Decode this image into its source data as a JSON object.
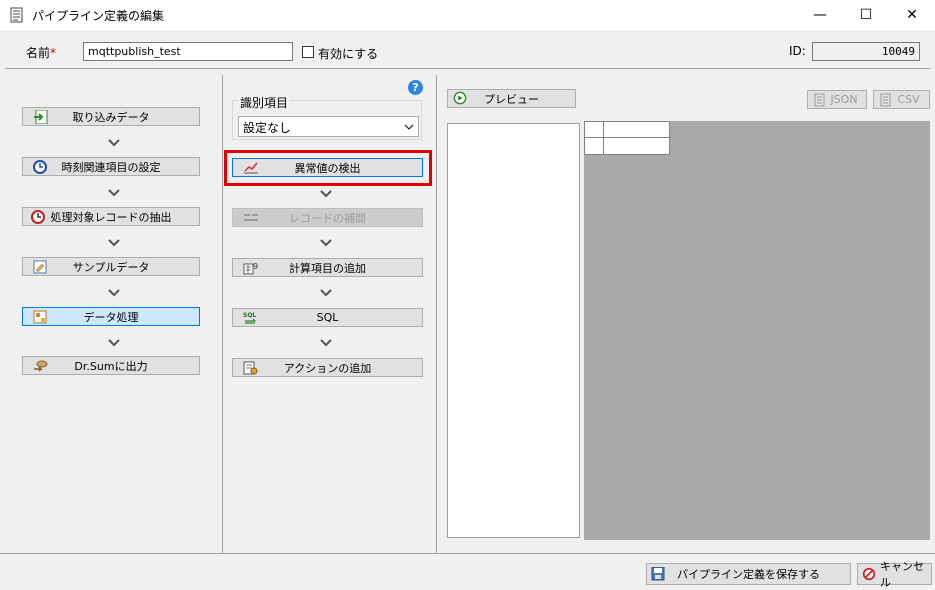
{
  "window": {
    "title": "パイプライン定義の編集",
    "minimize": "—",
    "maximize": "☐",
    "close": "✕"
  },
  "header": {
    "name_label": "名前",
    "required_mark": "*",
    "name_value": "mqttpublish_test",
    "enable_label": "有効にする",
    "id_label": "ID:",
    "id_value": "10049"
  },
  "steps": [
    {
      "label": "取り込みデータ",
      "icon": "import-icon"
    },
    {
      "label": "時刻関連項目の設定",
      "icon": "clock-icon"
    },
    {
      "label": "処理対象レコードの抽出",
      "icon": "extract-icon"
    },
    {
      "label": "サンプルデータ",
      "icon": "sample-icon"
    },
    {
      "label": "データ処理",
      "icon": "process-icon",
      "selected": true
    },
    {
      "label": "Dr.Sumに出力",
      "icon": "output-icon"
    }
  ],
  "middle": {
    "ident_label": "識別項目",
    "ident_value": "設定なし",
    "help": "?",
    "actions": [
      {
        "label": "異常値の検出",
        "icon": "anomaly-icon",
        "highlighted": true
      },
      {
        "label": "レコードの補間",
        "icon": "interpolate-icon",
        "disabled": true
      },
      {
        "label": "計算項目の追加",
        "icon": "calc-icon"
      },
      {
        "label": "SQL",
        "icon": "sql-icon"
      },
      {
        "label": "アクションの追加",
        "icon": "action-icon"
      }
    ]
  },
  "preview": {
    "preview_label": "プレビュー",
    "json_label": "JSON",
    "csv_label": "CSV"
  },
  "footer": {
    "save_label": "パイプライン定義を保存する",
    "cancel_label": "キャンセル"
  },
  "colors": {
    "highlight_border": "#e00000",
    "selected_bg": "#cce8ff",
    "selected_border": "#0078d7",
    "grid_bg": "#a9a9a9"
  }
}
